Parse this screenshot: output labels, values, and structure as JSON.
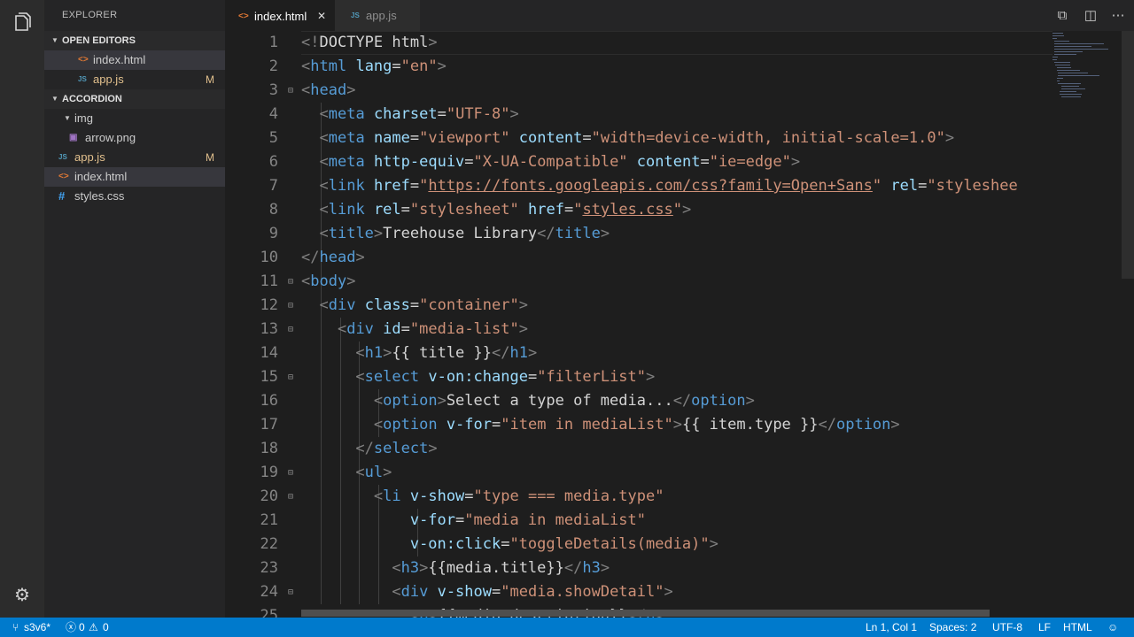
{
  "explorer_title": "EXPLORER",
  "open_editors": {
    "label": "OPEN EDITORS",
    "files": [
      {
        "name": "index.html",
        "icon": "html-file-icon",
        "badge": ""
      },
      {
        "name": "app.js",
        "icon": "js-file-icon",
        "badge": "M"
      }
    ]
  },
  "project": {
    "label": "ACCORDION",
    "folder": "img",
    "files": [
      {
        "name": "arrow.png",
        "icon": "image-file-icon",
        "badge": ""
      },
      {
        "name": "app.js",
        "icon": "js-file-icon",
        "badge": "M"
      },
      {
        "name": "index.html",
        "icon": "html-file-icon",
        "badge": ""
      },
      {
        "name": "styles.css",
        "icon": "css-file-icon",
        "badge": ""
      }
    ]
  },
  "tabs": [
    {
      "label": "index.html",
      "active": true
    },
    {
      "label": "app.js",
      "active": false
    }
  ],
  "icon_glyphs": {
    "html": "<>",
    "js": "JS",
    "css": "#"
  },
  "status": {
    "branch": "s3v6*",
    "errors": "0",
    "warnings": "0",
    "position": "Ln 1, Col 1",
    "spaces": "Spaces: 2",
    "encoding": "UTF-8",
    "eol": "LF",
    "language": "HTML"
  },
  "colors": {
    "statusbar": "#007acc",
    "tag": "#569cd6",
    "attribute": "#9cdcfe",
    "string": "#ce9178",
    "modified": "#e2c08d"
  },
  "editor": {
    "lines": [
      {
        "n": "1",
        "fold": false,
        "tokens": [
          [
            "p",
            "<!"
          ],
          [
            "x",
            "DOCTYPE html"
          ],
          [
            "p",
            ">"
          ]
        ]
      },
      {
        "n": "2",
        "fold": false,
        "tokens": [
          [
            "p",
            "<"
          ],
          [
            "t",
            "html"
          ],
          [
            "x",
            " "
          ],
          [
            "a",
            "lang"
          ],
          [
            "x",
            "="
          ],
          [
            "s",
            "\"en\""
          ],
          [
            "p",
            ">"
          ]
        ]
      },
      {
        "n": "3",
        "fold": true,
        "tokens": [
          [
            "p",
            "<"
          ],
          [
            "t",
            "head"
          ],
          [
            "p",
            ">"
          ]
        ]
      },
      {
        "n": "4",
        "fold": false,
        "tokens": [
          [
            "x",
            "  "
          ],
          [
            "p",
            "<"
          ],
          [
            "t",
            "meta"
          ],
          [
            "x",
            " "
          ],
          [
            "a",
            "charset"
          ],
          [
            "x",
            "="
          ],
          [
            "s",
            "\"UTF-8\""
          ],
          [
            "p",
            ">"
          ]
        ]
      },
      {
        "n": "5",
        "fold": false,
        "tokens": [
          [
            "x",
            "  "
          ],
          [
            "p",
            "<"
          ],
          [
            "t",
            "meta"
          ],
          [
            "x",
            " "
          ],
          [
            "a",
            "name"
          ],
          [
            "x",
            "="
          ],
          [
            "s",
            "\"viewport\""
          ],
          [
            "x",
            " "
          ],
          [
            "a",
            "content"
          ],
          [
            "x",
            "="
          ],
          [
            "s",
            "\"width=device-width, initial-scale=1.0\""
          ],
          [
            "p",
            ">"
          ]
        ]
      },
      {
        "n": "6",
        "fold": false,
        "tokens": [
          [
            "x",
            "  "
          ],
          [
            "p",
            "<"
          ],
          [
            "t",
            "meta"
          ],
          [
            "x",
            " "
          ],
          [
            "a",
            "http-equiv"
          ],
          [
            "x",
            "="
          ],
          [
            "s",
            "\"X-UA-Compatible\""
          ],
          [
            "x",
            " "
          ],
          [
            "a",
            "content"
          ],
          [
            "x",
            "="
          ],
          [
            "s",
            "\"ie=edge\""
          ],
          [
            "p",
            ">"
          ]
        ]
      },
      {
        "n": "7",
        "fold": false,
        "tokens": [
          [
            "x",
            "  "
          ],
          [
            "p",
            "<"
          ],
          [
            "t",
            "link"
          ],
          [
            "x",
            " "
          ],
          [
            "a",
            "href"
          ],
          [
            "x",
            "="
          ],
          [
            "s",
            "\""
          ],
          [
            "u",
            "https://fonts.googleapis.com/css?family=Open+Sans"
          ],
          [
            "s",
            "\""
          ],
          [
            "x",
            " "
          ],
          [
            "a",
            "rel"
          ],
          [
            "x",
            "="
          ],
          [
            "s",
            "\"styleshee"
          ]
        ]
      },
      {
        "n": "8",
        "fold": false,
        "tokens": [
          [
            "x",
            "  "
          ],
          [
            "p",
            "<"
          ],
          [
            "t",
            "link"
          ],
          [
            "x",
            " "
          ],
          [
            "a",
            "rel"
          ],
          [
            "x",
            "="
          ],
          [
            "s",
            "\"stylesheet\""
          ],
          [
            "x",
            " "
          ],
          [
            "a",
            "href"
          ],
          [
            "x",
            "="
          ],
          [
            "s",
            "\""
          ],
          [
            "u",
            "styles.css"
          ],
          [
            "s",
            "\""
          ],
          [
            "p",
            ">"
          ]
        ]
      },
      {
        "n": "9",
        "fold": false,
        "tokens": [
          [
            "x",
            "  "
          ],
          [
            "p",
            "<"
          ],
          [
            "t",
            "title"
          ],
          [
            "p",
            ">"
          ],
          [
            "x",
            "Treehouse Library"
          ],
          [
            "p",
            "</"
          ],
          [
            "t",
            "title"
          ],
          [
            "p",
            ">"
          ]
        ]
      },
      {
        "n": "10",
        "fold": false,
        "tokens": [
          [
            "p",
            "</"
          ],
          [
            "t",
            "head"
          ],
          [
            "p",
            ">"
          ]
        ]
      },
      {
        "n": "11",
        "fold": true,
        "tokens": [
          [
            "p",
            "<"
          ],
          [
            "t",
            "body"
          ],
          [
            "p",
            ">"
          ]
        ]
      },
      {
        "n": "12",
        "fold": true,
        "tokens": [
          [
            "x",
            "  "
          ],
          [
            "p",
            "<"
          ],
          [
            "t",
            "div"
          ],
          [
            "x",
            " "
          ],
          [
            "a",
            "class"
          ],
          [
            "x",
            "="
          ],
          [
            "s",
            "\"container\""
          ],
          [
            "p",
            ">"
          ]
        ]
      },
      {
        "n": "13",
        "fold": true,
        "tokens": [
          [
            "x",
            "    "
          ],
          [
            "p",
            "<"
          ],
          [
            "t",
            "div"
          ],
          [
            "x",
            " "
          ],
          [
            "a",
            "id"
          ],
          [
            "x",
            "="
          ],
          [
            "s",
            "\"media-list\""
          ],
          [
            "p",
            ">"
          ]
        ]
      },
      {
        "n": "14",
        "fold": false,
        "tokens": [
          [
            "x",
            "      "
          ],
          [
            "p",
            "<"
          ],
          [
            "t",
            "h1"
          ],
          [
            "p",
            ">"
          ],
          [
            "x",
            "{{ title }}"
          ],
          [
            "p",
            "</"
          ],
          [
            "t",
            "h1"
          ],
          [
            "p",
            ">"
          ]
        ]
      },
      {
        "n": "15",
        "fold": true,
        "tokens": [
          [
            "x",
            "      "
          ],
          [
            "p",
            "<"
          ],
          [
            "t",
            "select"
          ],
          [
            "x",
            " "
          ],
          [
            "a",
            "v-on:change"
          ],
          [
            "x",
            "="
          ],
          [
            "s",
            "\"filterList\""
          ],
          [
            "p",
            ">"
          ]
        ]
      },
      {
        "n": "16",
        "fold": false,
        "tokens": [
          [
            "x",
            "        "
          ],
          [
            "p",
            "<"
          ],
          [
            "t",
            "option"
          ],
          [
            "p",
            ">"
          ],
          [
            "x",
            "Select a type of media..."
          ],
          [
            "p",
            "</"
          ],
          [
            "t",
            "option"
          ],
          [
            "p",
            ">"
          ]
        ]
      },
      {
        "n": "17",
        "fold": false,
        "tokens": [
          [
            "x",
            "        "
          ],
          [
            "p",
            "<"
          ],
          [
            "t",
            "option"
          ],
          [
            "x",
            " "
          ],
          [
            "a",
            "v-for"
          ],
          [
            "x",
            "="
          ],
          [
            "s",
            "\"item in mediaList\""
          ],
          [
            "p",
            ">"
          ],
          [
            "x",
            "{{ item.type }}"
          ],
          [
            "p",
            "</"
          ],
          [
            "t",
            "option"
          ],
          [
            "p",
            ">"
          ]
        ]
      },
      {
        "n": "18",
        "fold": false,
        "tokens": [
          [
            "x",
            "      "
          ],
          [
            "p",
            "</"
          ],
          [
            "t",
            "select"
          ],
          [
            "p",
            ">"
          ]
        ]
      },
      {
        "n": "19",
        "fold": true,
        "tokens": [
          [
            "x",
            "      "
          ],
          [
            "p",
            "<"
          ],
          [
            "t",
            "ul"
          ],
          [
            "p",
            ">"
          ]
        ]
      },
      {
        "n": "20",
        "fold": true,
        "tokens": [
          [
            "x",
            "        "
          ],
          [
            "p",
            "<"
          ],
          [
            "t",
            "li"
          ],
          [
            "x",
            " "
          ],
          [
            "a",
            "v-show"
          ],
          [
            "x",
            "="
          ],
          [
            "s",
            "\"type === media.type\""
          ]
        ]
      },
      {
        "n": "21",
        "fold": false,
        "tokens": [
          [
            "x",
            "            "
          ],
          [
            "a",
            "v-for"
          ],
          [
            "x",
            "="
          ],
          [
            "s",
            "\"media in mediaList\""
          ]
        ]
      },
      {
        "n": "22",
        "fold": false,
        "tokens": [
          [
            "x",
            "            "
          ],
          [
            "a",
            "v-on:click"
          ],
          [
            "x",
            "="
          ],
          [
            "s",
            "\"toggleDetails(media)\""
          ],
          [
            "p",
            ">"
          ]
        ]
      },
      {
        "n": "23",
        "fold": false,
        "tokens": [
          [
            "x",
            "          "
          ],
          [
            "p",
            "<"
          ],
          [
            "t",
            "h3"
          ],
          [
            "p",
            ">"
          ],
          [
            "x",
            "{{media.title}}"
          ],
          [
            "p",
            "</"
          ],
          [
            "t",
            "h3"
          ],
          [
            "p",
            ">"
          ]
        ]
      },
      {
        "n": "24",
        "fold": true,
        "tokens": [
          [
            "x",
            "          "
          ],
          [
            "p",
            "<"
          ],
          [
            "t",
            "div"
          ],
          [
            "x",
            " "
          ],
          [
            "a",
            "v-show"
          ],
          [
            "x",
            "="
          ],
          [
            "s",
            "\"media.showDetail\""
          ],
          [
            "p",
            ">"
          ]
        ]
      },
      {
        "n": "25",
        "fold": false,
        "tokens": [
          [
            "x",
            "            "
          ],
          [
            "p",
            "<"
          ],
          [
            "t",
            "p"
          ],
          [
            "p",
            ">"
          ],
          [
            "x",
            "{{media.description}}"
          ],
          [
            "p",
            "</"
          ],
          [
            "t",
            "p"
          ],
          [
            "p",
            ">"
          ]
        ]
      }
    ]
  }
}
